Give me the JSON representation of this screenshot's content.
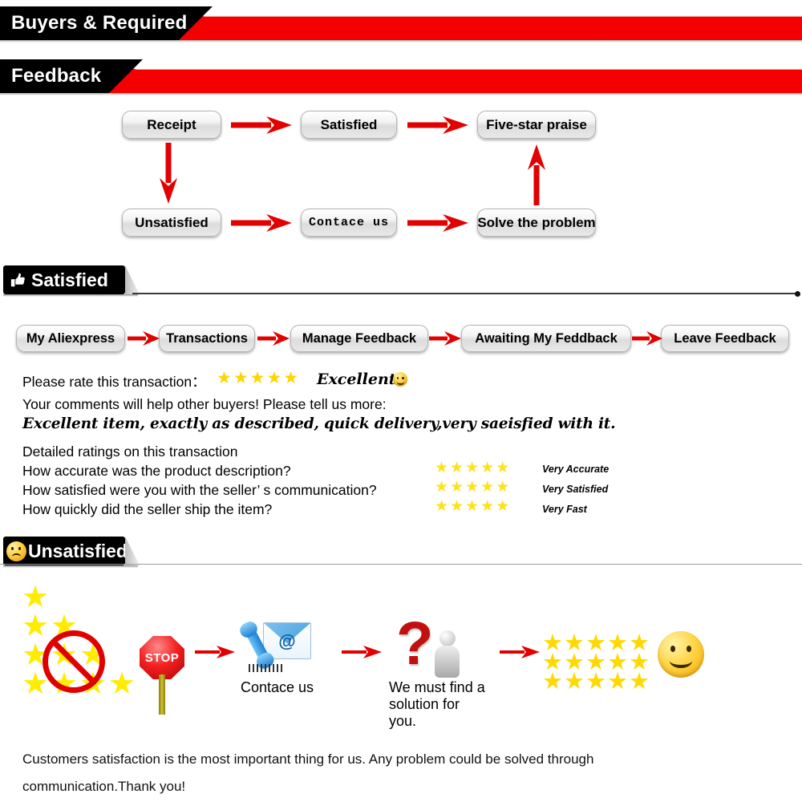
{
  "banners": [
    {
      "title": "Buyers & Required"
    },
    {
      "title": "Feedback"
    }
  ],
  "flowchart": {
    "nodes": [
      {
        "label": "Receipt"
      },
      {
        "label": "Satisfied"
      },
      {
        "label": "Five-star praise"
      },
      {
        "label": "Unsatisfied"
      },
      {
        "label": "Contace us"
      },
      {
        "label": "Solve the problem"
      }
    ]
  },
  "satisfied_section": {
    "heading": "Satisfied",
    "heading_icon": "thumbs-up-icon",
    "breadcrumb": [
      {
        "label": "My Aliexpress"
      },
      {
        "label": "Transactions"
      },
      {
        "label": "Manage Feedback"
      },
      {
        "label": "Awaiting My Feddback"
      },
      {
        "label": "Leave Feedback"
      }
    ],
    "rate_prompt": "Please rate this transaction：",
    "rate_stars": "★★★★★",
    "rate_word": "Excellent",
    "rate_emoji": "smiley-face-icon",
    "comments_prompt": "Your comments will help other buyers! Please tell us more:",
    "comment_text": "Excellent item, exactly as described, quick delivery,very saeisfied with it.",
    "detailed_heading": "Detailed ratings on this transaction",
    "detailed_rows": [
      {
        "question": "How accurate was the product description?",
        "stars": "★★★★★",
        "rating": "Very Accurate"
      },
      {
        "question": "How satisfied were you with the seller’ s communication?",
        "stars": "★★★★★",
        "rating": "Very Satisfied"
      },
      {
        "question": "How quickly did the seller ship the item?",
        "stars": "★★★★★",
        "rating": "Very Fast"
      }
    ]
  },
  "unsatisfied_section": {
    "heading": "Unsatisfied",
    "heading_icon": "sad-face-icon",
    "bad_stars_icon": "no-low-rating-icon",
    "stop_label": "STOP",
    "contact_caption": "Contace us",
    "contact_icon": "phone-envelope-icon",
    "solution_caption": "We must find a solution for you.",
    "solution_icon": "question-mark-person-icon",
    "good_stars_rows": [
      "★★★★★",
      "★★★★★",
      "★★★★★"
    ],
    "result_emoji": "smiley-face-icon"
  },
  "footer": {
    "line1": "Customers satisfaction is the most important thing for us. Any problem could be solved through",
    "line2": "communication.Thank you!"
  },
  "colors": {
    "banner_red": "#f50000",
    "banner_black": "#000000",
    "arrow_red": "#e20000",
    "star_gold": "#FFE11A",
    "star_yellow": "#FFEC00",
    "rule_dark": "#3b3b3b"
  }
}
